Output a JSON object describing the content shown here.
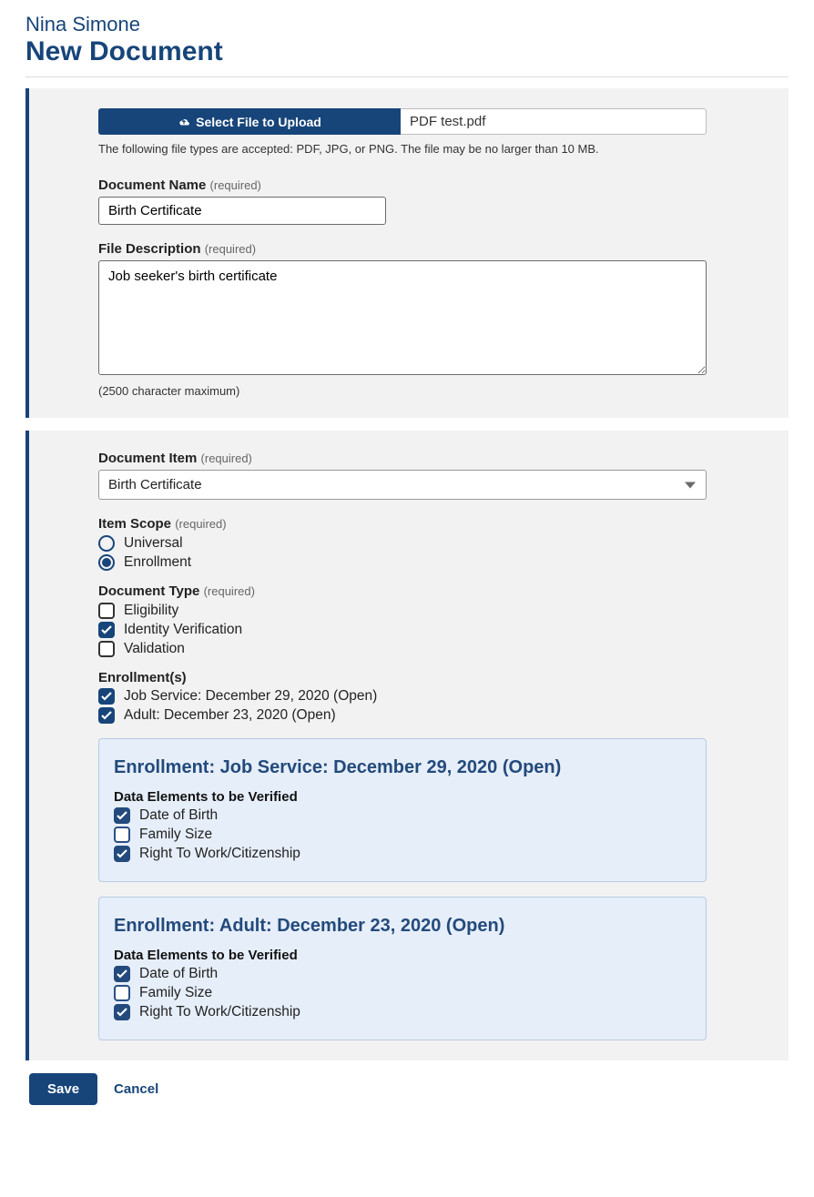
{
  "person_name": "Nina Simone",
  "page_title": "New Document",
  "upload": {
    "select_button": "Select File to Upload",
    "filename": "PDF test.pdf",
    "help": "The following file types are accepted: PDF, JPG, or PNG. The file may be no larger than 10 MB."
  },
  "required_text": "(required)",
  "doc_name": {
    "label": "Document Name",
    "value": "Birth Certificate"
  },
  "file_desc": {
    "label": "File Description",
    "value": "Job seeker's birth certificate",
    "max_note": "(2500 character maximum)"
  },
  "doc_item": {
    "label": "Document Item",
    "selected": "Birth Certificate"
  },
  "item_scope": {
    "label": "Item Scope",
    "options": [
      {
        "label": "Universal",
        "checked": false
      },
      {
        "label": "Enrollment",
        "checked": true
      }
    ]
  },
  "doc_type": {
    "label": "Document Type",
    "options": [
      {
        "label": "Eligibility",
        "checked": false
      },
      {
        "label": "Identity Verification",
        "checked": true
      },
      {
        "label": "Validation",
        "checked": false
      }
    ]
  },
  "enrollments": {
    "label": "Enrollment(s)",
    "items": [
      {
        "label": "Job Service: December 29, 2020 (Open)",
        "checked": true
      },
      {
        "label": "Adult: December 23, 2020 (Open)",
        "checked": true
      }
    ]
  },
  "panels": [
    {
      "title": "Enrollment: Job Service: December 29, 2020 (Open)",
      "subheading": "Data Elements to be Verified",
      "options": [
        {
          "label": "Date of Birth",
          "checked": true
        },
        {
          "label": "Family Size",
          "checked": false
        },
        {
          "label": "Right To Work/Citizenship",
          "checked": true
        }
      ]
    },
    {
      "title": "Enrollment: Adult: December 23, 2020 (Open)",
      "subheading": "Data Elements to be Verified",
      "options": [
        {
          "label": "Date of Birth",
          "checked": true
        },
        {
          "label": "Family Size",
          "checked": false
        },
        {
          "label": "Right To Work/Citizenship",
          "checked": true
        }
      ]
    }
  ],
  "footer": {
    "save": "Save",
    "cancel": "Cancel"
  }
}
